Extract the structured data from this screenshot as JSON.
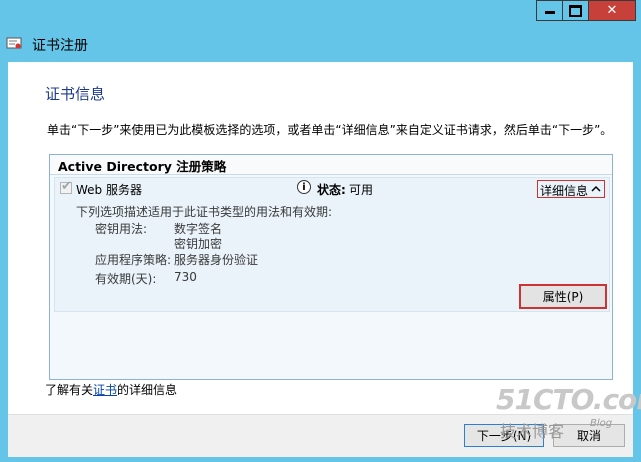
{
  "window": {
    "title": "证书注册",
    "minimize": "▬",
    "maximize": "□",
    "close": "✕"
  },
  "section_title": "证书信息",
  "instruction": "单击“下一步”来使用已为此模板选择的选项，或者单击“详细信息”来自定义证书请求，然后单击“下一步”。",
  "policy": {
    "header": "Active Directory 注册策略",
    "item": {
      "checked": true,
      "name": "Web 服务器",
      "status_label": "状态:",
      "status_value": "可用",
      "details_label": "详细信息",
      "details_chevron": "^",
      "description": "下列选项描述适用于此证书类型的用法和有效期:",
      "key_usage_label": "密钥用法:",
      "key_usage_values": [
        "数字签名",
        "密钥加密"
      ],
      "app_policy_label": "应用程序策略:",
      "app_policy_value": "服务器身份验证",
      "validity_label": "有效期(天):",
      "validity_value": "730",
      "properties_button": "属性(P)"
    }
  },
  "learn_more": {
    "prefix": "了解有关",
    "link": "证书",
    "suffix": "的详细信息"
  },
  "buttons": {
    "next": "下一步(N)",
    "cancel": "取消"
  },
  "watermark": {
    "logo": "51CTO.com",
    "subtitle": "技术博客",
    "blog": "Blog"
  }
}
